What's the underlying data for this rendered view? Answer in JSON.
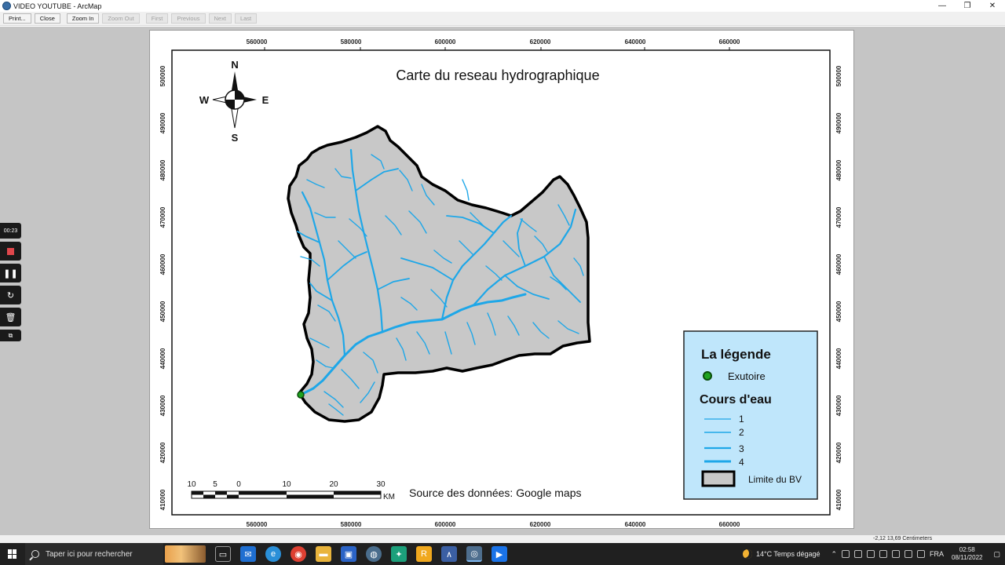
{
  "window": {
    "title": "VIDEO YOUTUBE - ArcMap",
    "minimize": "—",
    "maximize": "❐",
    "close": "✕"
  },
  "toolbar": {
    "print": "Print...",
    "close": "Close",
    "zoom_in": "Zoom In",
    "zoom_out": "Zoom Out",
    "first": "First",
    "previous": "Previous",
    "next": "Next",
    "last": "Last"
  },
  "map": {
    "title": "Carte du reseau hydrographique",
    "north_label": "N",
    "south_label": "S",
    "west_label": "W",
    "east_label": "E",
    "x_ticks": [
      "560000",
      "580000",
      "600000",
      "620000",
      "640000",
      "660000"
    ],
    "y_ticks": [
      "500000",
      "490000",
      "480000",
      "470000",
      "460000",
      "450000",
      "440000",
      "430000",
      "420000",
      "410000"
    ],
    "scale_labels": [
      "10",
      "5",
      "0",
      "10",
      "20",
      "30"
    ],
    "scale_unit": "KM",
    "source": "Source des données: Google maps",
    "colors": {
      "basin_fill": "#c8c8c8",
      "river": "#1ea7e8",
      "legend_bg": "#bfe6fb",
      "outlet": "#1fa31f"
    }
  },
  "legend": {
    "title": "La légende",
    "outlet_label": "Exutoire",
    "streams_title": "Cours d'eau",
    "stream_orders": [
      "1",
      "2",
      "3",
      "4"
    ],
    "boundary_label": "Limite du BV"
  },
  "recorder": {
    "time": "00:23"
  },
  "status": {
    "coords": "-2,12  13,69 Centimeters"
  },
  "taskbar": {
    "search_placeholder": "Taper ici pour rechercher",
    "weather": "14°C  Temps dégagé",
    "language": "FRA",
    "time": "02:58",
    "date": "08/11/2022"
  }
}
